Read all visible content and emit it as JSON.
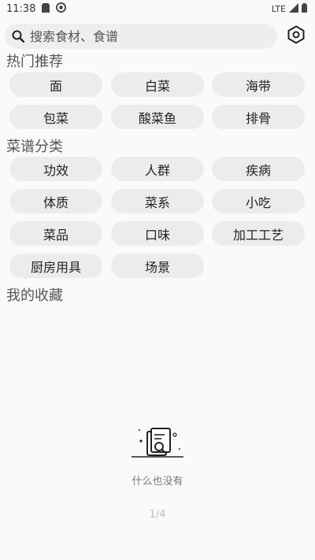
{
  "status": {
    "time": "11:38",
    "network": "LTE"
  },
  "search": {
    "placeholder": "搜索食材、食谱"
  },
  "hot": {
    "title": "热门推荐",
    "items": [
      "面",
      "白菜",
      "海带",
      "包菜",
      "酸菜鱼",
      "排骨"
    ]
  },
  "categories": {
    "title": "菜谱分类",
    "items": [
      "功效",
      "人群",
      "疾病",
      "体质",
      "菜系",
      "小吃",
      "菜品",
      "口味",
      "加工工艺",
      "厨房用具",
      "场景"
    ]
  },
  "favorites": {
    "title": "我的收藏",
    "empty_text": "什么也没有"
  },
  "pager": {
    "text": "1/4"
  }
}
